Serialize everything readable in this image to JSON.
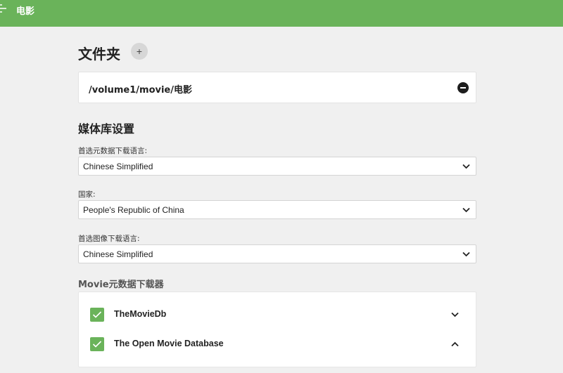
{
  "header": {
    "title": "电影",
    "back_icon": "back-arrow-icon",
    "bg_color": "#6ab35a"
  },
  "folders": {
    "title": "文件夹",
    "add_label": "+",
    "items": [
      {
        "path": "/volume1/movie/电影"
      }
    ]
  },
  "library_settings": {
    "title": "媒体库设置",
    "metadata_language": {
      "label": "首选元数据下载语言:",
      "value": "Chinese Simplified"
    },
    "country": {
      "label": "国家:",
      "value": "People's Republic of China"
    },
    "image_language": {
      "label": "首选图像下载语言:",
      "value": "Chinese Simplified"
    }
  },
  "metadata_fetchers": {
    "title": "Movie元数据下载器",
    "items": [
      {
        "name": "TheMovieDb",
        "checked": true,
        "expanded": false
      },
      {
        "name": "The Open Movie Database",
        "checked": true,
        "expanded": true
      }
    ]
  }
}
